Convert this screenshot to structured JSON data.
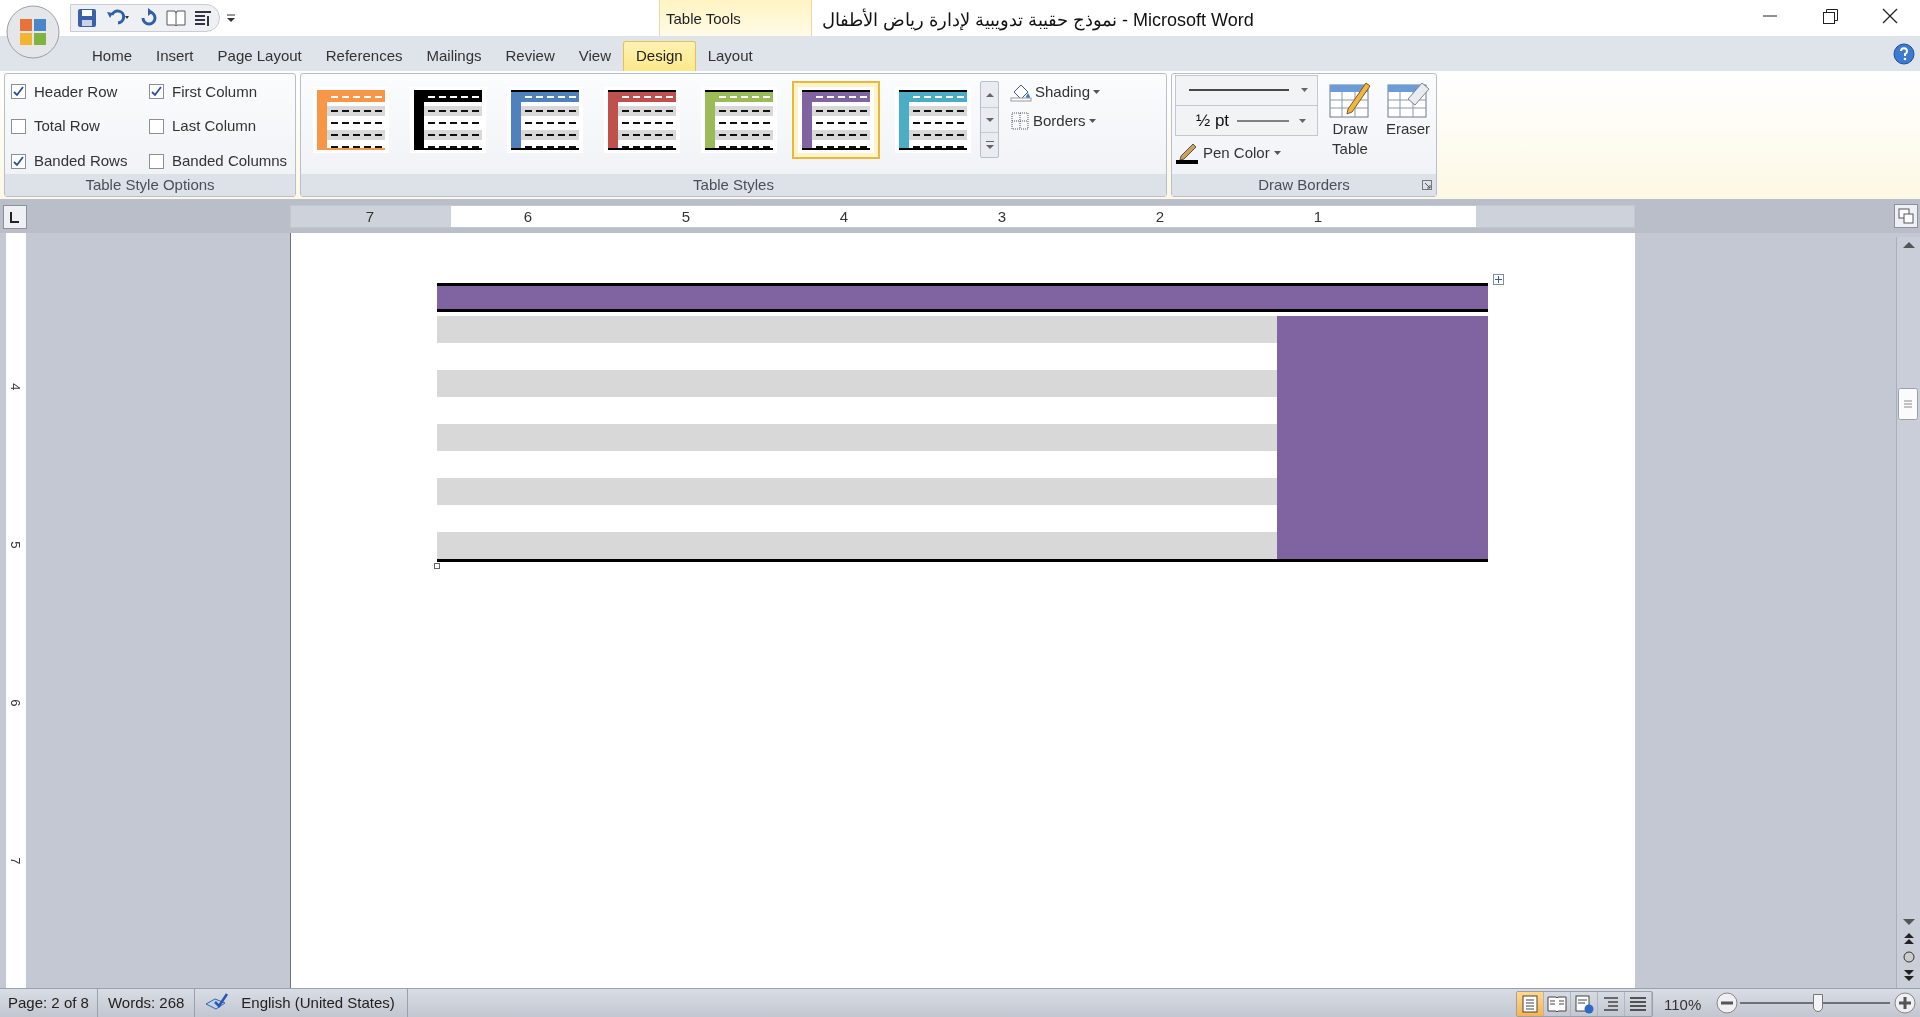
{
  "title_bar": {
    "context_tab": "Table Tools",
    "title": "نموذج حقيبة تدويبية لإدارة رياض الأطفال - Microsoft Word"
  },
  "ribbon_tabs": [
    {
      "label": "Home",
      "selected": false
    },
    {
      "label": "Insert",
      "selected": false
    },
    {
      "label": "Page Layout",
      "selected": false
    },
    {
      "label": "References",
      "selected": false
    },
    {
      "label": "Mailings",
      "selected": false
    },
    {
      "label": "Review",
      "selected": false
    },
    {
      "label": "View",
      "selected": false
    },
    {
      "label": "Design",
      "selected": true
    },
    {
      "label": "Layout",
      "selected": false
    }
  ],
  "table_style_options": {
    "label": "Table Style Options",
    "options": [
      {
        "label": "Header Row",
        "checked": true
      },
      {
        "label": "First Column",
        "checked": true
      },
      {
        "label": "Total Row",
        "checked": false
      },
      {
        "label": "Last Column",
        "checked": false
      },
      {
        "label": "Banded Rows",
        "checked": true
      },
      {
        "label": "Banded Columns",
        "checked": false
      }
    ]
  },
  "table_styles": {
    "label": "Table Styles",
    "shading": "Shading",
    "borders": "Borders",
    "styles": [
      {
        "color": "#f79646",
        "selected": false
      },
      {
        "color": "#000000",
        "selected": false
      },
      {
        "color": "#4f81bd",
        "selected": false
      },
      {
        "color": "#c0504d",
        "selected": false
      },
      {
        "color": "#9bbb59",
        "selected": false
      },
      {
        "color": "#8064a2",
        "selected": true
      },
      {
        "color": "#4bacc6",
        "selected": false
      }
    ]
  },
  "draw_borders": {
    "label": "Draw Borders",
    "pen_weight": "½ pt",
    "pen_color": "Pen Color",
    "draw_table": "Draw Table",
    "eraser": "Eraser"
  },
  "horizontal_ruler": [
    "7",
    "6",
    "5",
    "4",
    "3",
    "2",
    "1"
  ],
  "vertical_ruler": [
    "4",
    "5",
    "6",
    "7"
  ],
  "document_table": {
    "rows": [
      {
        "kind": "header"
      },
      {
        "kind": "band"
      },
      {
        "kind": "plain"
      },
      {
        "kind": "band"
      },
      {
        "kind": "plain"
      },
      {
        "kind": "band"
      },
      {
        "kind": "plain"
      },
      {
        "kind": "band"
      },
      {
        "kind": "plain"
      },
      {
        "kind": "band"
      }
    ]
  },
  "status_bar": {
    "page": "Page: 2 of 8",
    "words": "Words: 268",
    "language": "English (United States)",
    "views": [
      {
        "kind": "print-layout",
        "selected": true
      },
      {
        "kind": "reading",
        "selected": false
      },
      {
        "kind": "web",
        "selected": false
      },
      {
        "kind": "outline",
        "selected": false
      },
      {
        "kind": "draft",
        "selected": false
      }
    ],
    "zoom": {
      "label": "110%",
      "level": 0.52
    }
  }
}
